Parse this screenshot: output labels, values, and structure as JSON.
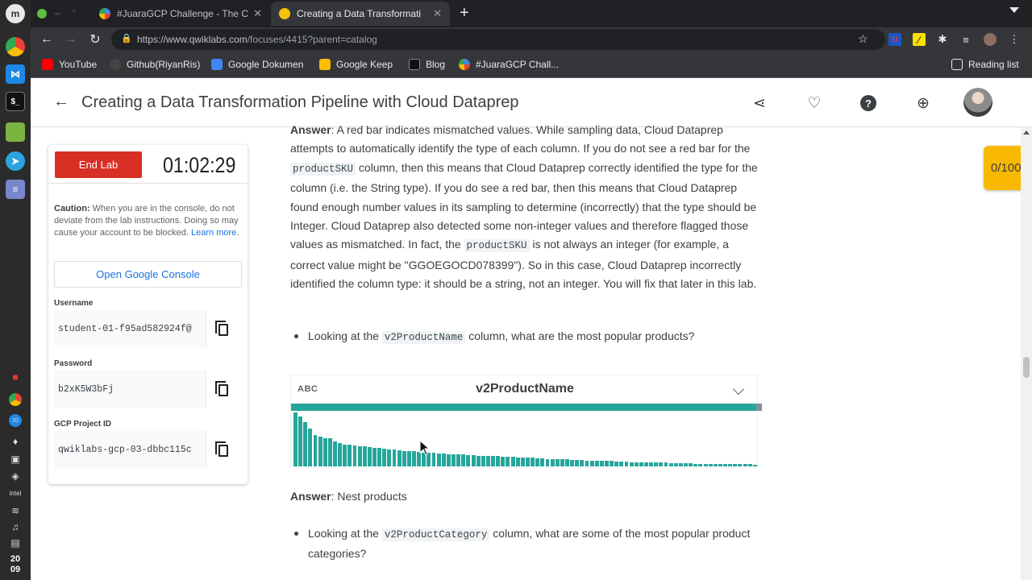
{
  "browser": {
    "tabs": [
      {
        "title": "#JuaraGCP Challenge - The Cl",
        "active": false
      },
      {
        "title": "Creating a Data Transformati",
        "active": true
      }
    ],
    "url": "https://www.qwiklabs.com/focuses/4415?parent=catalog",
    "url_domain": "https://www.qwiklabs.com",
    "url_path": "/focuses/4415?parent=catalog",
    "bookmarks": [
      "YouTube",
      "Github(RiyanRis)",
      "Google Dokumen",
      "Google Keep",
      "Blog",
      "#JuaraGCP Chall..."
    ],
    "reading_list": "Reading list"
  },
  "os": {
    "clock_hour": "20",
    "clock_minute": "09",
    "badge": "20"
  },
  "app": {
    "title": "Creating a Data Transformation Pipeline with Cloud Dataprep"
  },
  "panel": {
    "end_lab_label": "End Lab",
    "timer": "01:02:29",
    "caution_label": "Caution:",
    "caution_text": " When you are in the console, do not deviate from the lab instructions. Doing so may cause your account to be blocked. ",
    "learn_more": "Learn more.",
    "console_button": "Open Google Console",
    "username_label": "Username",
    "username_value": "student-01-f95ad582924f@",
    "password_label": "Password",
    "password_value": "b2xK5W3bFj",
    "project_label": "GCP Project ID",
    "project_value": "qwiklabs-gcp-03-dbbc115c"
  },
  "score": "0/100",
  "content": {
    "answer_label": "Answer",
    "answer1_a": ": A red bar indicates mismatched values. While sampling data, Cloud Dataprep attempts to automatically identify the type of each column. If you do not see a red bar for the ",
    "code_productsku": "productSKU",
    "answer1_b": " column, then this means that Cloud Dataprep correctly identified the type for the column (i.e. the String type). If you do see a red bar, then this means that Cloud Dataprep found enough number values in its sampling to determine (incorrectly) that the type should be Integer. Cloud Dataprep also detected some non-integer values and therefore flagged those values as mismatched. In fact, the ",
    "answer1_c": " is not always an integer (for example, a correct value might be \"GGOEGOCD078399\"). So in this case, Cloud Dataprep incorrectly identified the column type: it should be a string, not an integer. You will fix that later in this lab.",
    "bullet1_a": "Looking at the ",
    "code_v2productname": "v2ProductName",
    "bullet1_b": " column, what are the most popular products?",
    "column_type": "ABC",
    "column_name": "v2ProductName",
    "answer2": ": Nest products",
    "bullet2_a": "Looking at the ",
    "code_v2productcategory": "v2ProductCategory",
    "bullet2_b": " column, what are some of the most popular product categories?"
  },
  "histogram": {
    "valid_fraction": 0.986,
    "bar_heights": [
      1.0,
      0.93,
      0.82,
      0.7,
      0.58,
      0.55,
      0.53,
      0.52,
      0.46,
      0.43,
      0.41,
      0.4,
      0.39,
      0.38,
      0.37,
      0.36,
      0.35,
      0.34,
      0.33,
      0.32,
      0.31,
      0.3,
      0.29,
      0.29,
      0.28,
      0.27,
      0.26,
      0.26,
      0.25,
      0.24,
      0.24,
      0.23,
      0.23,
      0.22,
      0.22,
      0.21,
      0.21,
      0.2,
      0.2,
      0.2,
      0.19,
      0.19,
      0.18,
      0.18,
      0.18,
      0.17,
      0.17,
      0.16,
      0.16,
      0.15,
      0.15,
      0.14,
      0.14,
      0.14,
      0.13,
      0.13,
      0.12,
      0.12,
      0.12,
      0.11,
      0.11,
      0.11,
      0.1,
      0.1,
      0.1,
      0.09,
      0.09,
      0.09,
      0.08,
      0.08,
      0.08,
      0.08,
      0.07,
      0.07,
      0.07,
      0.07,
      0.06,
      0.06,
      0.06,
      0.06,
      0.06,
      0.05,
      0.05,
      0.05,
      0.05,
      0.05,
      0.05,
      0.04,
      0.04,
      0.04,
      0.04,
      0.04,
      0.04,
      0.03
    ]
  }
}
